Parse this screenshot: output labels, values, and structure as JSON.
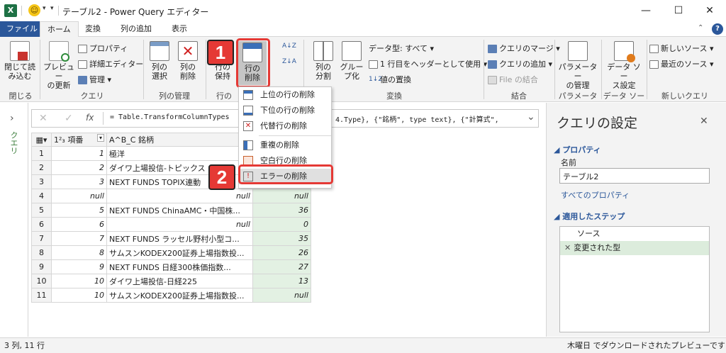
{
  "app": {
    "title": "テーブル2 - Power Query エディター",
    "excel_glyph": "X",
    "smiley": "☺",
    "qat_arrow": "▾",
    "qat_more": "▾"
  },
  "window": {
    "minimize": "—",
    "maximize": "☐",
    "close": "✕"
  },
  "tabs": [
    "ファイル",
    "ホーム",
    "変換",
    "列の追加",
    "表示"
  ],
  "ribbon": {
    "close_load": "閉じて読\nみ込む",
    "close_group": "閉じる",
    "preview_refresh": "プレビュー\nの更新",
    "properties": "プロパティ",
    "advanced_editor": "詳細エディター",
    "manage": "管理",
    "query_group": "クエリ",
    "choose_columns": "列の\n選択",
    "remove_columns": "列の\n削除",
    "column_mgmt_group": "列の管理",
    "keep_rows": "行の\n保持",
    "remove_rows": "行の\n削除",
    "rows_group": "行の",
    "sort_az": "A↓Z",
    "sort_za": "Z↓A",
    "split_column": "列の\n分割",
    "group_by": "グルー\nプ化",
    "data_type": "データ型: すべて",
    "first_row_header": "1 行目をヘッダーとして使用",
    "replace_values": "値の置換",
    "transform_group": "変換",
    "merge_queries": "クエリのマージ",
    "append_queries": "クエリの追加",
    "combine_files": "File の結合",
    "combine_group": "結合",
    "manage_parameters": "パラメーター\nの管理",
    "params_group": "パラメーター",
    "data_source_settings": "データ ソー\nス設定",
    "datasource_group": "データ ソース",
    "new_source": "新しいソース",
    "recent_sources": "最近のソース",
    "new_query_group": "新しいクエリ"
  },
  "dropdown": {
    "items": [
      "上位の行の削除",
      "下位の行の削除",
      "代替行の削除",
      "重複の削除",
      "空白行の削除",
      "エラーの削除"
    ]
  },
  "callouts": {
    "one": "1",
    "two": "2"
  },
  "formula": {
    "text": "= Table.TransformColumnTypes",
    "text_tail": "4.Type}, {\"銘柄\", type text}, {\"計算式\",",
    "cancel": "✕",
    "confirm": "✓",
    "fx": "fx",
    "expand": "⌄"
  },
  "left_pane": {
    "arrow": "›",
    "label": "クエリ"
  },
  "grid": {
    "headers": [
      "1²₃ 項番",
      "A^B_C 銘柄"
    ],
    "rows": [
      {
        "n": "1",
        "num": "1",
        "name": "極洋",
        "val": ""
      },
      {
        "n": "2",
        "num": "2",
        "name": "ダイワ上場投信-トピックス",
        "val": ""
      },
      {
        "n": "3",
        "num": "3",
        "name": "NEXT FUNDS TOPIX連動",
        "val": ""
      },
      {
        "n": "4",
        "num": "null",
        "name": "null",
        "val": "null"
      },
      {
        "n": "5",
        "num": "5",
        "name": "NEXT FUNDS ChinaAMC・中国株...",
        "val": "36"
      },
      {
        "n": "6",
        "num": "6",
        "name": "null",
        "val": "0"
      },
      {
        "n": "7",
        "num": "7",
        "name": "NEXT FUNDS ラッセル野村小型コ...",
        "val": "35"
      },
      {
        "n": "8",
        "num": "8",
        "name": "サムスンKODEX200証券上場指数投...",
        "val": "26"
      },
      {
        "n": "9",
        "num": "9",
        "name": "NEXT FUNDS 日経300株価指数...",
        "val": "27"
      },
      {
        "n": "10",
        "num": "10",
        "name": "ダイワ上場投信-日経225",
        "val": "13"
      },
      {
        "n": "11",
        "num": "10",
        "name": "サムスンKODEX200証券上場指数投...",
        "val": "null"
      }
    ]
  },
  "settings": {
    "title": "クエリの設定",
    "close": "✕",
    "properties_header": "プロパティ",
    "name_label": "名前",
    "name_value": "テーブル2",
    "all_properties": "すべてのプロパティ",
    "steps_header": "適用したステップ",
    "steps": [
      "ソース",
      "変更された型"
    ],
    "step_delete": "✕"
  },
  "status": {
    "left": "3 列, 11 行",
    "right": "木曜日 でダウンロードされたプレビューです"
  },
  "colors": {
    "accent": "#2b579a",
    "callout": "#e53935",
    "excel": "#1e7145",
    "green_col": "#e3f1e3"
  }
}
